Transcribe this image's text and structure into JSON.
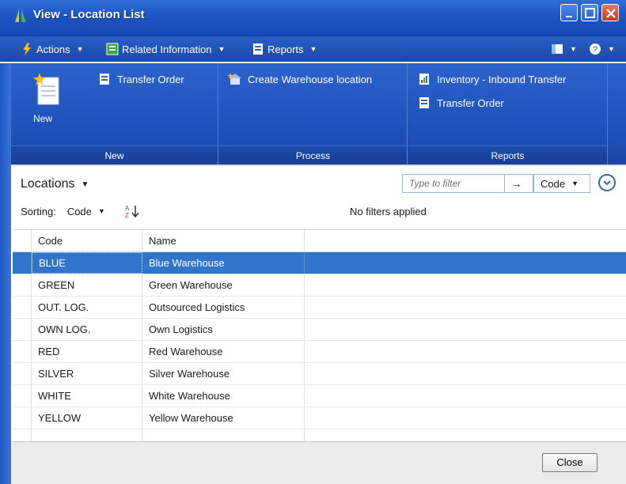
{
  "window": {
    "title": "View - Location List"
  },
  "command_bar": {
    "actions_label": "Actions",
    "related_label": "Related Information",
    "reports_label": "Reports"
  },
  "ribbon": {
    "groups": [
      {
        "label": "New",
        "big_button": "New",
        "items": [
          "Transfer Order"
        ]
      },
      {
        "label": "Process",
        "items": [
          "Create Warehouse location"
        ]
      },
      {
        "label": "Reports",
        "items": [
          "Inventory - Inbound Transfer",
          "Transfer Order"
        ]
      }
    ]
  },
  "list": {
    "title": "Locations",
    "filter_placeholder": "Type to filter",
    "filter_field": "Code",
    "sorting_label": "Sorting:",
    "sorting_field": "Code",
    "filters_status": "No filters applied",
    "columns": [
      "Code",
      "Name"
    ],
    "rows": [
      {
        "code": "BLUE",
        "name": "Blue Warehouse",
        "selected": true
      },
      {
        "code": "GREEN",
        "name": "Green Warehouse"
      },
      {
        "code": "OUT. LOG.",
        "name": "Outsourced Logistics"
      },
      {
        "code": "OWN LOG.",
        "name": "Own Logistics"
      },
      {
        "code": "RED",
        "name": "Red Warehouse"
      },
      {
        "code": "SILVER",
        "name": "Silver Warehouse"
      },
      {
        "code": "WHITE",
        "name": "White Warehouse"
      },
      {
        "code": "YELLOW",
        "name": "Yellow Warehouse"
      }
    ]
  },
  "footer": {
    "close_label": "Close"
  },
  "colors": {
    "title_blue": "#1d55c4",
    "ribbon_blue": "#1e50b8",
    "selection_blue": "#3174cc"
  },
  "icons": [
    "app-logo-icon",
    "lightning-icon",
    "related-info-icon",
    "reports-icon",
    "layout-icon",
    "help-icon",
    "new-document-icon",
    "transfer-order-icon",
    "create-warehouse-icon",
    "inventory-report-icon",
    "sort-direction-icon",
    "filter-arrow-icon",
    "expand-icon"
  ]
}
